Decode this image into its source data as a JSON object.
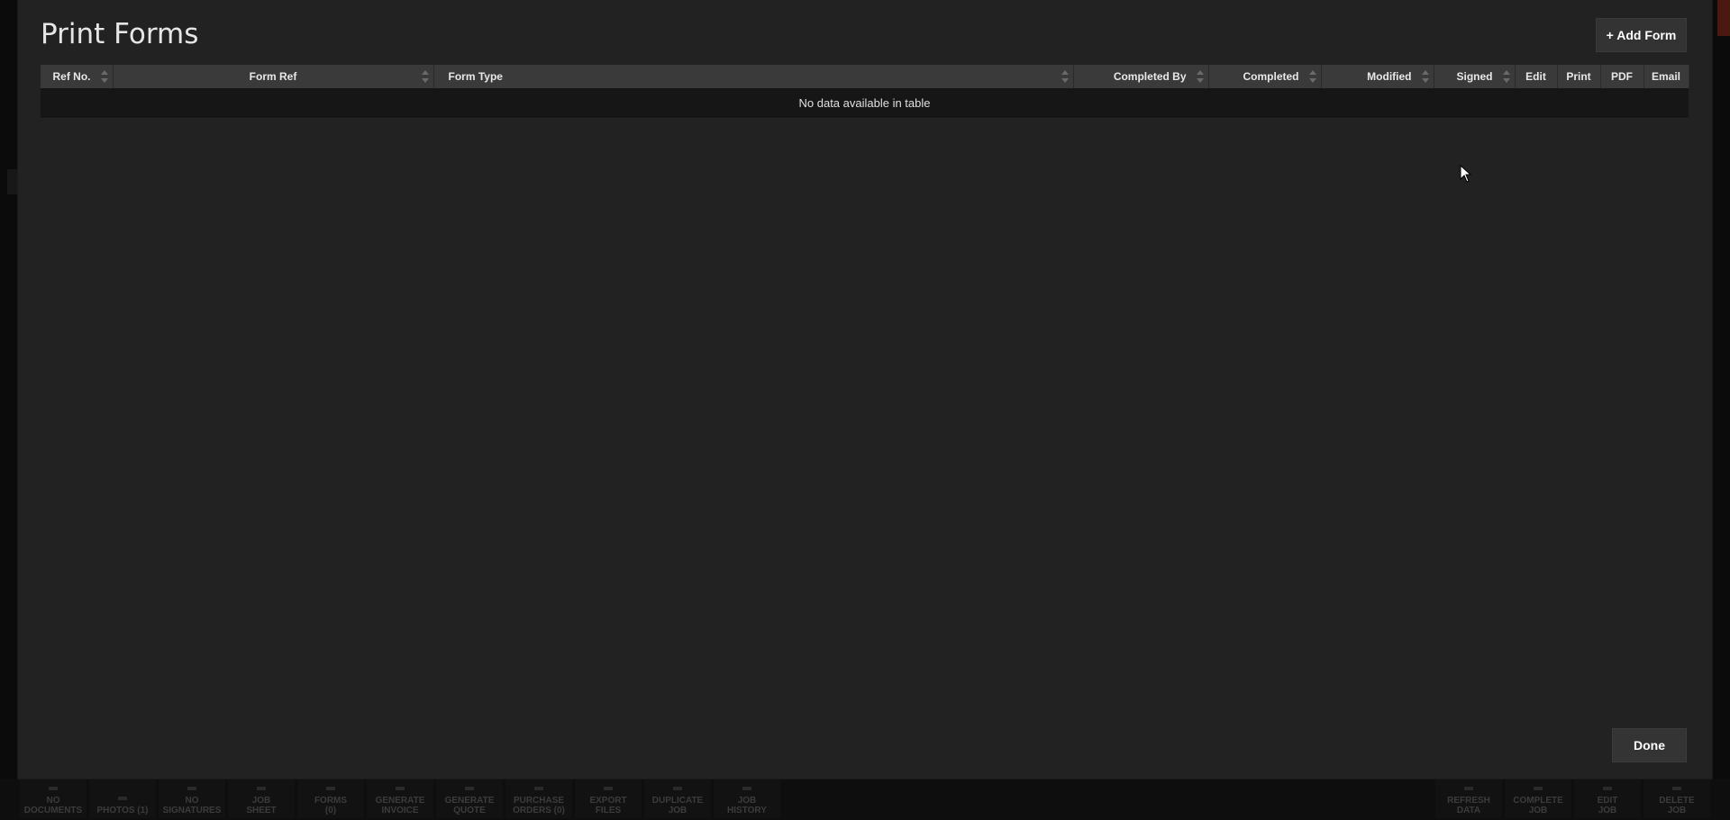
{
  "modal": {
    "title": "Print Forms",
    "add_form_label": "+ Add Form",
    "done_label": "Done"
  },
  "table": {
    "columns": [
      {
        "label": "Ref No.",
        "sortable": true
      },
      {
        "label": "Form Ref",
        "sortable": true
      },
      {
        "label": "Form Type",
        "sortable": true
      },
      {
        "label": "Completed By",
        "sortable": true
      },
      {
        "label": "Completed",
        "sortable": true
      },
      {
        "label": "Modified",
        "sortable": true
      },
      {
        "label": "Signed",
        "sortable": true
      },
      {
        "label": "Edit",
        "sortable": false
      },
      {
        "label": "Print",
        "sortable": false
      },
      {
        "label": "PDF",
        "sortable": false
      },
      {
        "label": "Email",
        "sortable": false
      }
    ],
    "empty_message": "No data available in table"
  },
  "bottom_bar": {
    "left_items": [
      {
        "line1": "NO",
        "line2": "DOCUMENTS"
      },
      {
        "line1": "PHOTOS (1)",
        "line2": ""
      },
      {
        "line1": "NO",
        "line2": "SIGNATURES"
      },
      {
        "line1": "JOB",
        "line2": "SHEET"
      },
      {
        "line1": "FORMS",
        "line2": "(0)"
      },
      {
        "line1": "GENERATE",
        "line2": "INVOICE"
      },
      {
        "line1": "GENERATE",
        "line2": "QUOTE"
      },
      {
        "line1": "PURCHASE",
        "line2": "ORDERS (0)"
      },
      {
        "line1": "EXPORT",
        "line2": "FILES"
      },
      {
        "line1": "DUPLICATE",
        "line2": "JOB"
      },
      {
        "line1": "JOB",
        "line2": "HISTORY"
      }
    ],
    "right_items": [
      {
        "line1": "REFRESH",
        "line2": "DATA"
      },
      {
        "line1": "COMPLETE",
        "line2": "JOB"
      },
      {
        "line1": "EDIT",
        "line2": "JOB"
      },
      {
        "line1": "DELETE",
        "line2": "JOB"
      }
    ]
  },
  "colors": {
    "modal_bg": "#222222",
    "header_bg": "#3a3a3a",
    "row_bg": "#161616",
    "button_bg": "#333333"
  }
}
